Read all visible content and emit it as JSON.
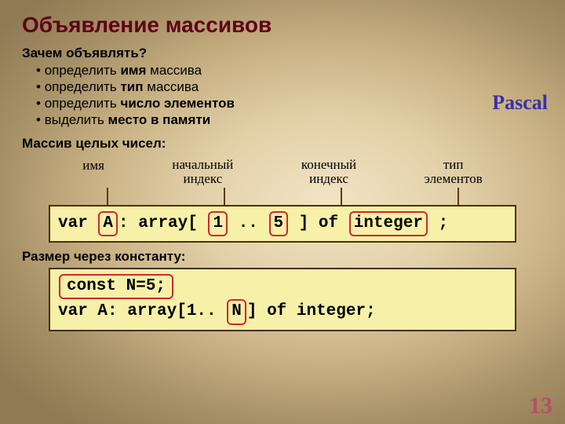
{
  "title": "Объявление массивов",
  "sideLabel": "Pascal",
  "why": {
    "question": "Зачем объявлять?",
    "items": [
      {
        "pre": "определить ",
        "bold": "имя",
        "post": " массива"
      },
      {
        "pre": "определить ",
        "bold": "тип",
        "post": " массива"
      },
      {
        "pre": "определить ",
        "bold": "число элементов",
        "post": ""
      },
      {
        "pre": "выделить ",
        "bold": "место в памяти",
        "post": ""
      }
    ]
  },
  "section1": "Массив целых чисел:",
  "labels": {
    "name": "имя",
    "start": "начальный индекс",
    "end": "конечный индекс",
    "type": "тип элементов"
  },
  "code1": {
    "kw_var": "var",
    "name": "A",
    "sep1": ": array[",
    "lo": "1",
    "sep2": ".. ",
    "hi": "5",
    "sep3": "] of",
    "type": "integer",
    "end": ";"
  },
  "section2": "Размер через константу:",
  "code2": {
    "line1a": "const ",
    "line1b": "N=5;",
    "line2a": "var A: array[1.. ",
    "line2b": "N",
    "line2c": "] of integer;"
  },
  "pagenum": "13"
}
